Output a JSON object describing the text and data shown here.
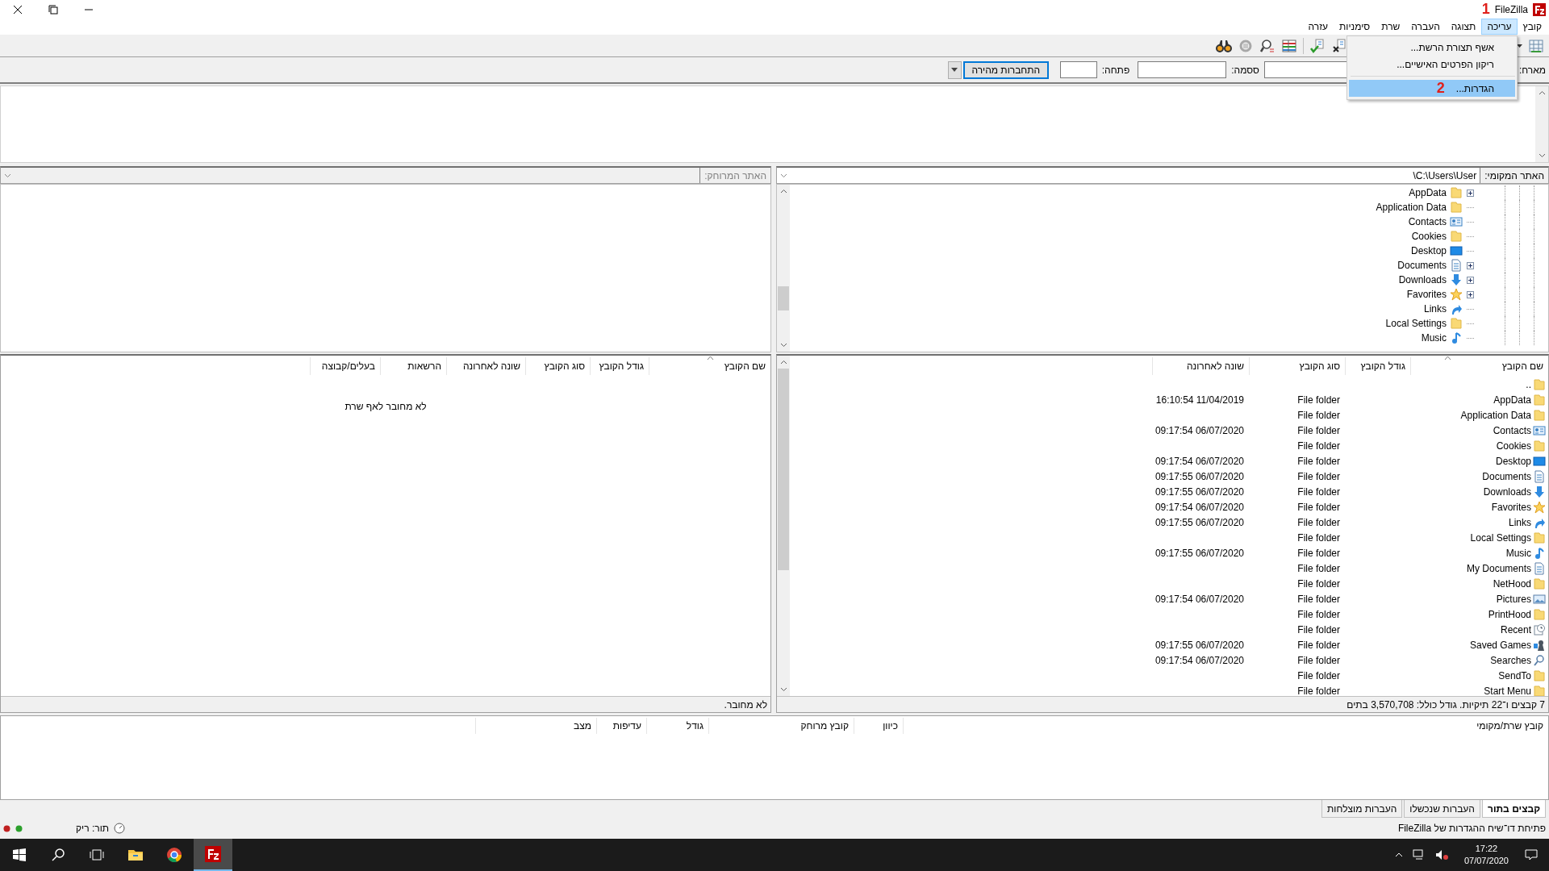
{
  "window": {
    "title": "FileZilla",
    "annotation": "1"
  },
  "menu": [
    {
      "label": "קובץ",
      "selected": false
    },
    {
      "label": "עריכה",
      "selected": true
    },
    {
      "label": "תצוגה",
      "selected": false
    },
    {
      "label": "העברה",
      "selected": false
    },
    {
      "label": "שרת",
      "selected": false
    },
    {
      "label": "סימניות",
      "selected": false
    },
    {
      "label": "עזרה",
      "selected": false
    }
  ],
  "edit_menu": [
    {
      "kind": "item",
      "label": "אשף תצורת הרשת...",
      "selected": false
    },
    {
      "kind": "item",
      "label": "ריקון הפרטים האישיים...",
      "selected": false
    },
    {
      "kind": "separator"
    },
    {
      "kind": "item",
      "label": "הגדרות...",
      "selected": true,
      "annotation": "2"
    }
  ],
  "quickconnect": {
    "host_label": "מארח:",
    "password_label": "ססמה:",
    "port_label": "פתחה:",
    "button": "התחברות מהירה"
  },
  "local_site": {
    "label": "האתר המקומי:",
    "path": "\\C:\\Users\\User",
    "tree": [
      {
        "name": "AppData",
        "kind": "folder",
        "expandable": true
      },
      {
        "name": "Application Data",
        "kind": "folder",
        "expandable": false
      },
      {
        "name": "Contacts",
        "kind": "contacts",
        "expandable": false
      },
      {
        "name": "Cookies",
        "kind": "folder",
        "expandable": false
      },
      {
        "name": "Desktop",
        "kind": "desktop",
        "expandable": false
      },
      {
        "name": "Documents",
        "kind": "documents",
        "expandable": true
      },
      {
        "name": "Downloads",
        "kind": "downloads",
        "expandable": true
      },
      {
        "name": "Favorites",
        "kind": "favorites",
        "expandable": true
      },
      {
        "name": "Links",
        "kind": "links",
        "expandable": false
      },
      {
        "name": "Local Settings",
        "kind": "folder",
        "expandable": false
      },
      {
        "name": "Music",
        "kind": "music",
        "expandable": false
      }
    ]
  },
  "remote_site": {
    "label": "האתר המרוחק:",
    "disabled": true
  },
  "local_files": {
    "columns": [
      "שם הקובץ",
      "גודל הקובץ",
      "סוג הקובץ",
      "שונה לאחרונה"
    ],
    "rows": [
      {
        "name": "..",
        "kind": "folder"
      },
      {
        "name": "AppData",
        "kind": "folder",
        "type": "File folder",
        "modified": "16:10:54 11/04/2019"
      },
      {
        "name": "Application Data",
        "kind": "folder",
        "type": "File folder"
      },
      {
        "name": "Contacts",
        "kind": "contacts",
        "type": "File folder",
        "modified": "09:17:54 06/07/2020"
      },
      {
        "name": "Cookies",
        "kind": "folder",
        "type": "File folder"
      },
      {
        "name": "Desktop",
        "kind": "desktop",
        "type": "File folder",
        "modified": "09:17:54 06/07/2020"
      },
      {
        "name": "Documents",
        "kind": "documents",
        "type": "File folder",
        "modified": "09:17:55 06/07/2020"
      },
      {
        "name": "Downloads",
        "kind": "downloads",
        "type": "File folder",
        "modified": "09:17:55 06/07/2020"
      },
      {
        "name": "Favorites",
        "kind": "favorites",
        "type": "File folder",
        "modified": "09:17:54 06/07/2020"
      },
      {
        "name": "Links",
        "kind": "links",
        "type": "File folder",
        "modified": "09:17:55 06/07/2020"
      },
      {
        "name": "Local Settings",
        "kind": "folder",
        "type": "File folder"
      },
      {
        "name": "Music",
        "kind": "music",
        "type": "File folder",
        "modified": "09:17:55 06/07/2020"
      },
      {
        "name": "My Documents",
        "kind": "documents",
        "type": "File folder"
      },
      {
        "name": "NetHood",
        "kind": "folder",
        "type": "File folder"
      },
      {
        "name": "Pictures",
        "kind": "pictures",
        "type": "File folder",
        "modified": "09:17:54 06/07/2020"
      },
      {
        "name": "PrintHood",
        "kind": "folder",
        "type": "File folder"
      },
      {
        "name": "Recent",
        "kind": "recent",
        "type": "File folder"
      },
      {
        "name": "Saved Games",
        "kind": "games",
        "type": "File folder",
        "modified": "09:17:55 06/07/2020"
      },
      {
        "name": "Searches",
        "kind": "searches",
        "type": "File folder",
        "modified": "09:17:54 06/07/2020"
      },
      {
        "name": "SendTo",
        "kind": "folder",
        "type": "File folder"
      },
      {
        "name": "Start Menu",
        "kind": "folder",
        "type": "File folder"
      }
    ],
    "status": "7 קבצים ו־22 תיקיות. גודל כולל: 3,570,708 בתים"
  },
  "remote_files": {
    "columns": [
      "שם הקובץ",
      "גודל הקובץ",
      "סוג הקובץ",
      "שונה לאחרונה",
      "הרשאות",
      "בעלים/קבוצה"
    ],
    "message": "לא מחובר לאף שרת",
    "status": "לא מחובר."
  },
  "queue": {
    "columns": [
      "קובץ שרת/מקומי",
      "כיוון",
      "קובץ מרוחק",
      "גודל",
      "עדיפות",
      "מצב"
    ],
    "tabs": [
      {
        "label": "קבצים בתור",
        "selected": true
      },
      {
        "label": "העברות שנכשלו",
        "selected": false
      },
      {
        "label": "העברות מוצלחות",
        "selected": false
      }
    ]
  },
  "status_bar": {
    "message": "פתיחת דו־שיח ההגדרות של FileZilla",
    "queue": "תור: ריק"
  },
  "taskbar": {
    "time": "17:22",
    "date": "07/07/2020"
  }
}
